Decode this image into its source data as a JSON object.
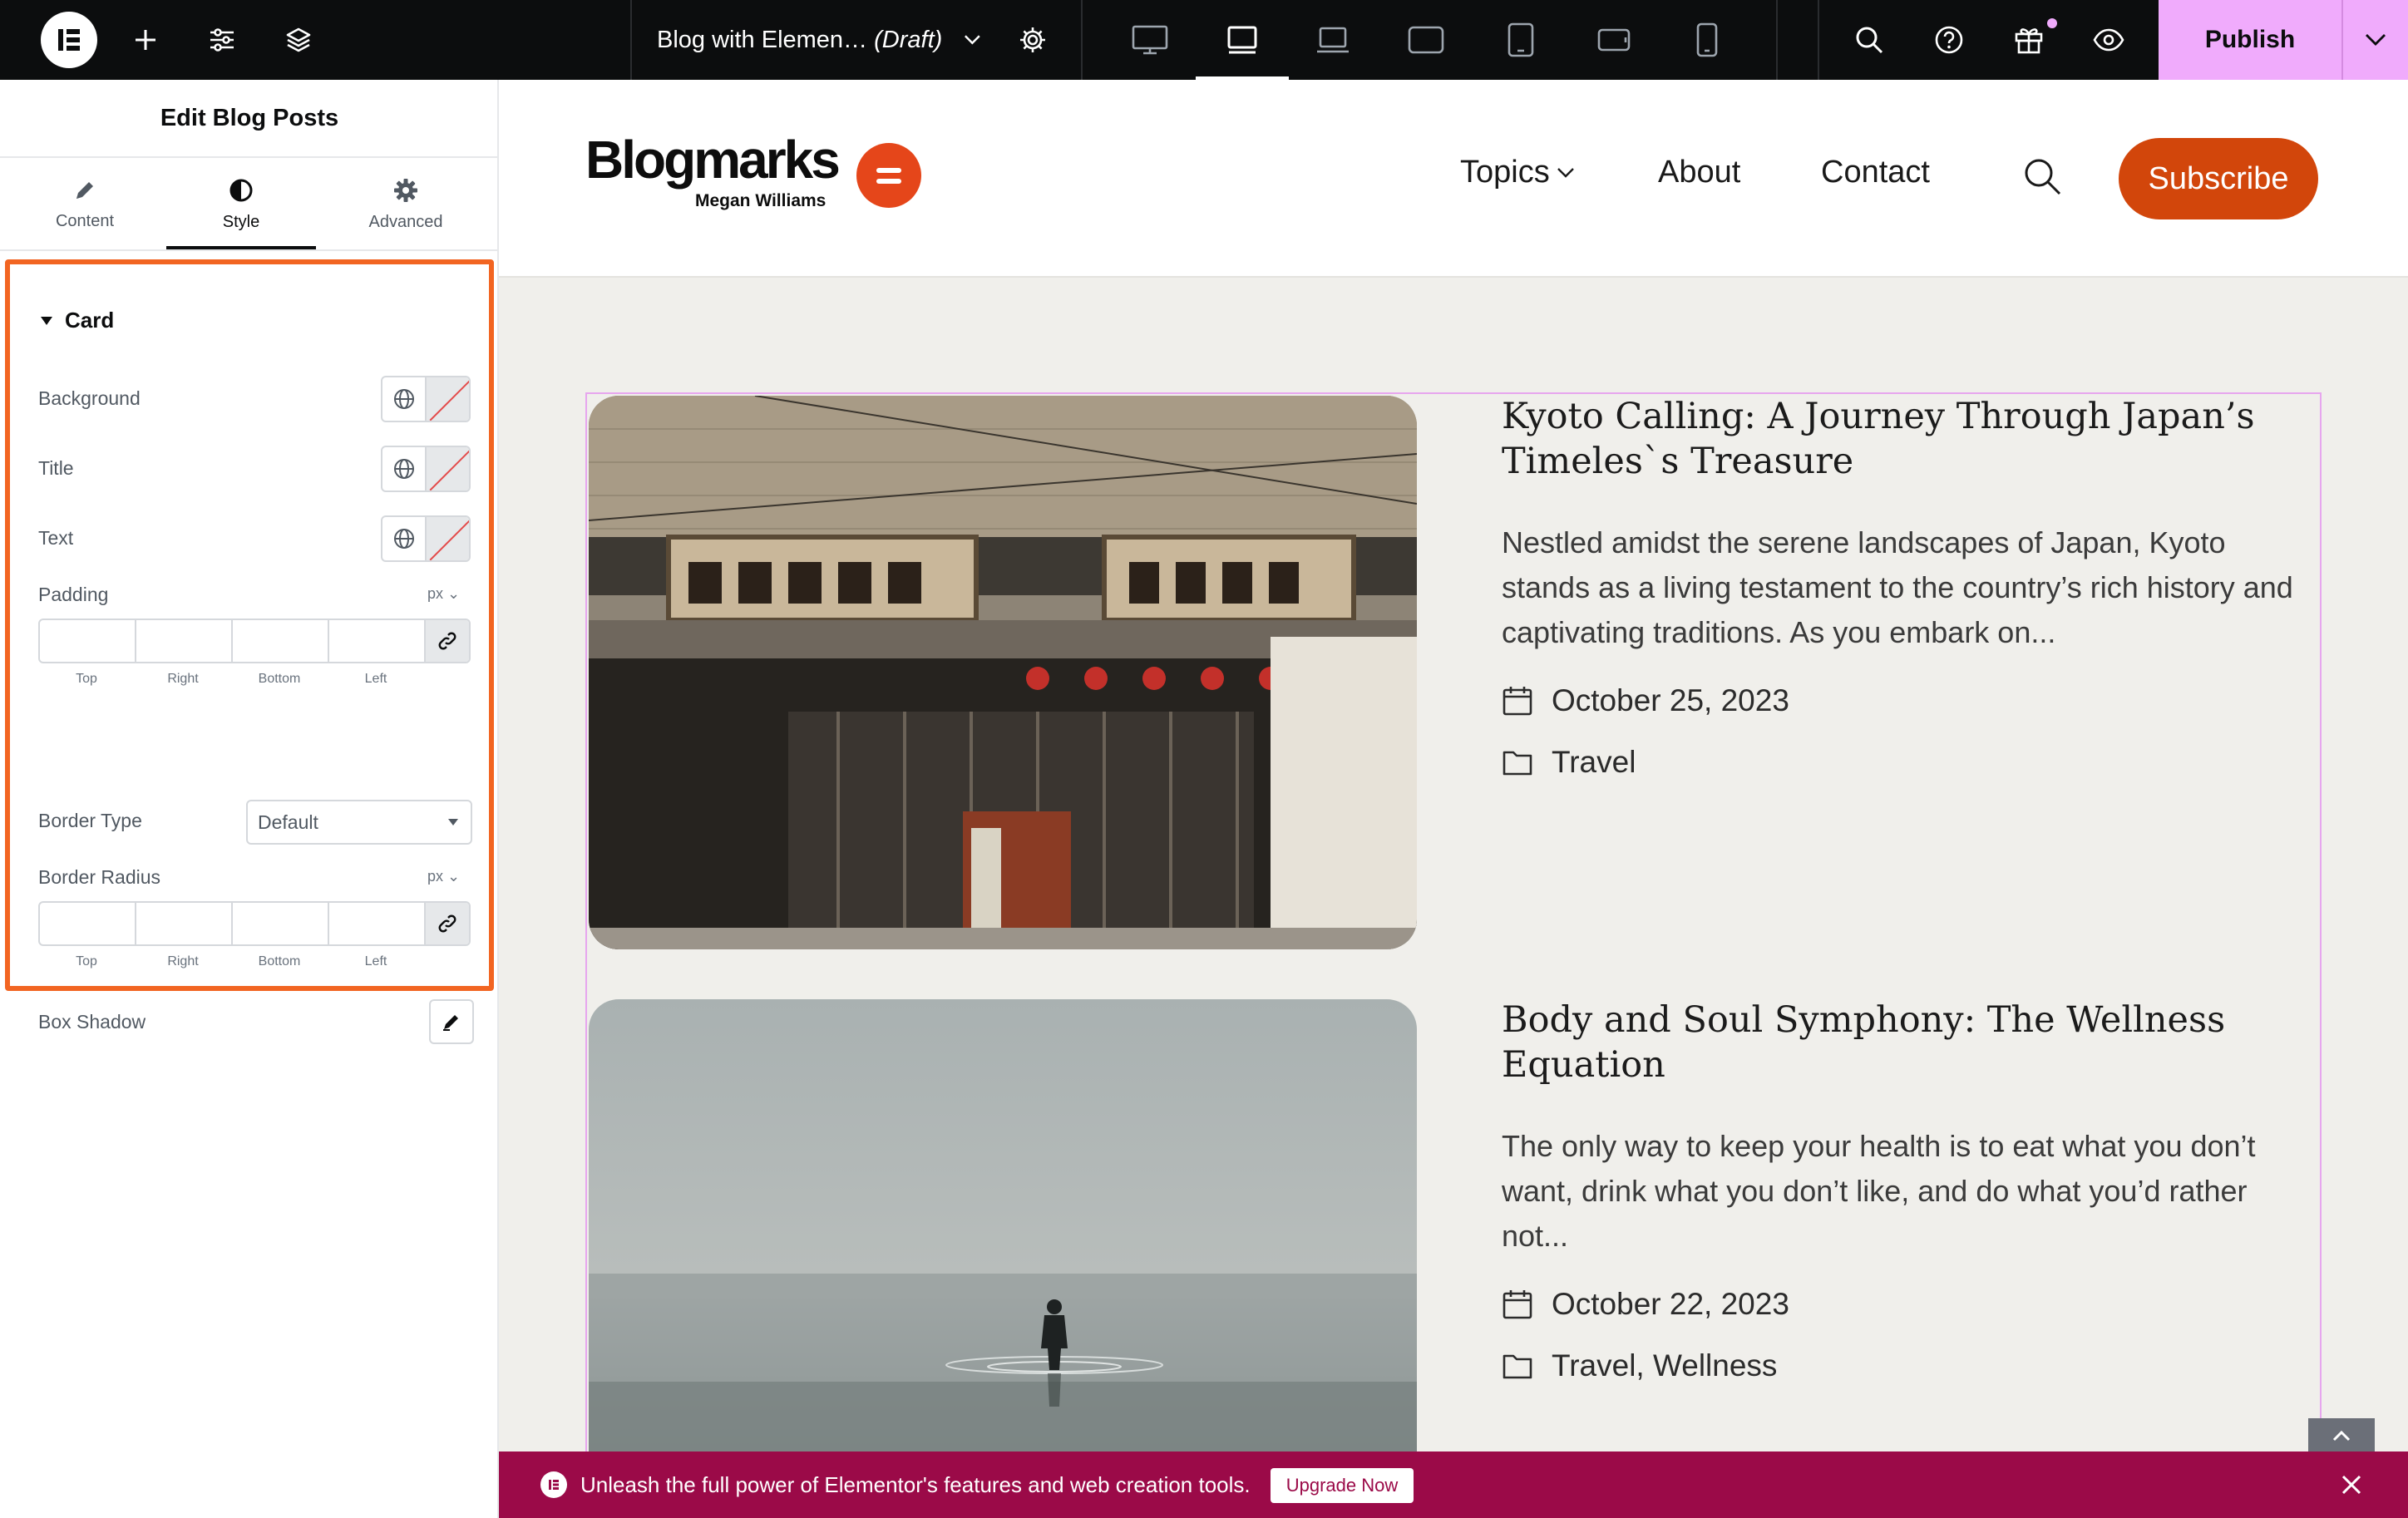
{
  "topbar": {
    "doc_title": "Blog with Elemen…",
    "doc_status": "(Draft)",
    "publish_label": "Publish",
    "icons": [
      "elementor-logo-icon",
      "add-icon",
      "site-settings-icon",
      "structure-icon",
      "chevron-down-icon",
      "page-settings-icon",
      "desktop-icon",
      "tablet-landscape-icon",
      "laptop-icon",
      "widescreen-icon",
      "tablet-portrait-icon",
      "mobile-landscape-icon",
      "mobile-icon",
      "search-icon",
      "help-icon",
      "whats-new-icon",
      "preview-icon"
    ]
  },
  "panel": {
    "title": "Edit Blog Posts",
    "tabs": [
      {
        "label": "Content",
        "icon": "pencil-icon"
      },
      {
        "label": "Style",
        "icon": "contrast-icon"
      },
      {
        "label": "Advanced",
        "icon": "gear-icon"
      }
    ],
    "section_title": "Card",
    "controls": {
      "background_label": "Background",
      "title_label": "Title",
      "text_label": "Text",
      "padding_label": "Padding",
      "padding_unit": "px",
      "dim_labels": [
        "Top",
        "Right",
        "Bottom",
        "Left"
      ],
      "border_type_label": "Border Type",
      "border_type_value": "Default",
      "border_radius_label": "Border Radius",
      "border_radius_unit": "px",
      "box_shadow_label": "Box Shadow"
    },
    "highlight_color": "#f26522"
  },
  "site": {
    "brand": "Blogmarks",
    "brand_sub": "Megan Williams",
    "nav": {
      "topics": "Topics",
      "about": "About",
      "contact": "Contact"
    },
    "subscribe_label": "Subscribe",
    "accent_color": "#d2460b",
    "posts": [
      {
        "title": "Kyoto Calling: A Journey Through Japan’s Timeles`s Treasure",
        "excerpt": "Nestled amidst the serene landscapes of Japan, Kyoto stands as a living testament to the country’s rich history and captivating traditions. As you embark on...",
        "date": "October 25, 2023",
        "categories": "Travel"
      },
      {
        "title": "Body and Soul Symphony: The Wellness Equation",
        "excerpt": "The only way to keep your health is to eat what you don’t want, drink what you don’t like, and do what you’d rather not...",
        "date": "October 22, 2023",
        "categories": "Travel, Wellness"
      }
    ]
  },
  "promo": {
    "text": "Unleash the full power of Elementor's features and web creation tools.",
    "button_label": "Upgrade Now",
    "background": "#9b0a48"
  }
}
